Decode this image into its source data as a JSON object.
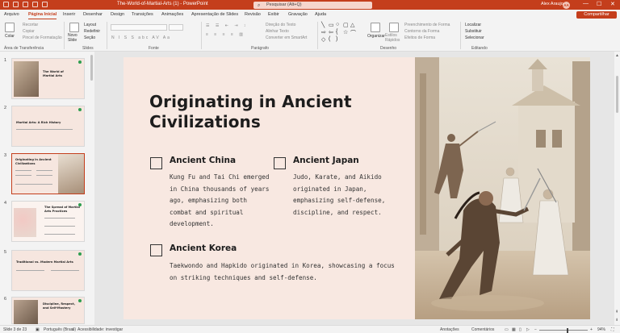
{
  "titlebar": {
    "doc_title": "The-World-of-Martial-Arts (1)  -  PowerPoint",
    "search_placeholder": "Pesquisar (Alt+Q)",
    "user_name": "Alex Araujo",
    "user_initials": "AA",
    "minimize": "—",
    "maximize": "☐",
    "close": "✕"
  },
  "tabs": [
    "Arquivo",
    "Página Inicial",
    "Inserir",
    "Desenhar",
    "Design",
    "Transições",
    "Animações",
    "Apresentação de Slides",
    "Revisão",
    "Exibir",
    "Gravação",
    "Ajuda"
  ],
  "active_tab": "Página Inicial",
  "share_label": "Compartilhar",
  "ribbon": {
    "clipboard": {
      "paste": "Colar",
      "cut": "Recortar",
      "copy": "Copiar",
      "format_painter": "Pincel de Formatação",
      "label": "Área de Transferência"
    },
    "slides": {
      "new_slide": "Novo Slide",
      "layout": "Layout",
      "reset": "Redefinir",
      "section": "Seção",
      "label": "Slides"
    },
    "font": {
      "label": "Fonte",
      "buttons": "N  I  S  S  abc  AV  Aa"
    },
    "paragraph": {
      "label": "Parágrafo",
      "text_direction": "Direção do Texto",
      "align_text": "Alinhar Texto",
      "smartart": "Converter em SmartArt"
    },
    "drawing": {
      "arrange": "Organizar",
      "quick_styles": "Estilos Rápidos",
      "shape_fill": "Preenchimento de Forma",
      "shape_outline": "Contorno da Forma",
      "shape_effects": "Efeitos de Forma",
      "label": "Desenho"
    },
    "editing": {
      "find": "Localizar",
      "replace": "Substituir",
      "select": "Selecionar",
      "label": "Editando"
    }
  },
  "thumbnails": [
    {
      "num": "1",
      "title": "The World of Martial Arts"
    },
    {
      "num": "2",
      "title": "Martial Arts: A Rich History"
    },
    {
      "num": "3",
      "title": "Originating in Ancient Civilizations"
    },
    {
      "num": "4",
      "title": "The Spread of Martial Arts Practices"
    },
    {
      "num": "5",
      "title": "Traditional vs. Modern Martial Arts"
    },
    {
      "num": "6",
      "title": "Discipline, Respect, and Self-Mastery"
    }
  ],
  "slide": {
    "title": "Originating in Ancient Civilizations",
    "sections": [
      {
        "heading": "Ancient China",
        "body": "Kung Fu and Tai Chi emerged in China thousands of years ago, emphasizing both combat and spiritual development."
      },
      {
        "heading": "Ancient Japan",
        "body": "Judo, Karate, and Aikido originated in Japan, emphasizing self-defense, discipline, and respect."
      },
      {
        "heading": "Ancient Korea",
        "body": "Taekwondo and Hapkido originated in Korea, showcasing a focus on striking techniques and self-defense."
      }
    ]
  },
  "status": {
    "slide_count": "Slide 3 de 23",
    "language": "Português (Brasil)",
    "accessibility": "Acessibilidade: investigar",
    "notes": "Anotações",
    "comments": "Comentários",
    "zoom": "94%"
  },
  "colors": {
    "accent": "#c43e1c",
    "slide_bg": "#f8e8e1",
    "thumb_star": "#2e9e4f"
  }
}
